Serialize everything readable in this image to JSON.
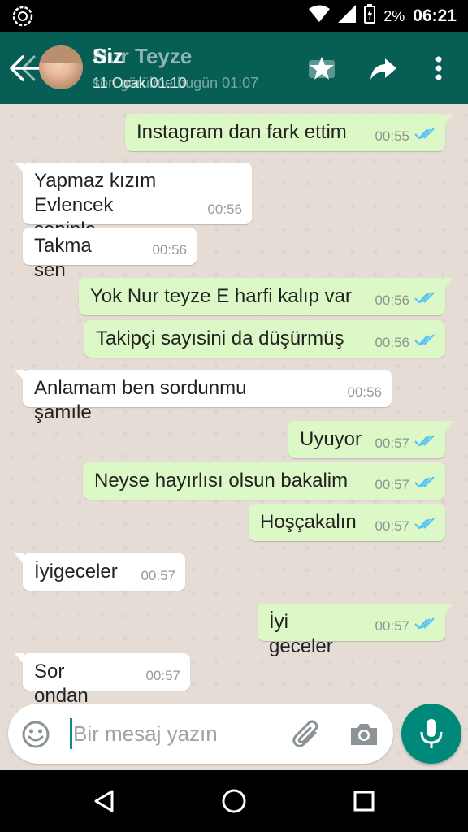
{
  "status_bar": {
    "battery_percent": "2%",
    "time": "06:21",
    "icons": [
      "notification-ring-icon",
      "wifi-icon",
      "signal-icon",
      "battery-charging-icon"
    ]
  },
  "header": {
    "name_ghost": "Nur Teyze",
    "name": "Siz",
    "subtitle_ghost": "son görülme bugün 01:07",
    "subtitle": "11 Ocak 01:10",
    "icons": [
      "back-arrow-icon",
      "avatar",
      "star-icon",
      "forward-icon",
      "more-vert-icon"
    ]
  },
  "messages": [
    {
      "dir": "out",
      "text": "Instagram dan fark ettim",
      "time": "00:55",
      "ticks": true
    },
    {
      "dir": "in",
      "text": "Yapmaz kızım\nEvlencek seninle",
      "time": "00:56",
      "ticks": false
    },
    {
      "dir": "in",
      "text": "Takma sen",
      "time": "00:56",
      "ticks": false
    },
    {
      "dir": "out",
      "text": "Yok Nur teyze E harfi kalıp var",
      "time": "00:56",
      "ticks": true
    },
    {
      "dir": "out",
      "text": "Takipçi sayısini da düşürmüş",
      "time": "00:56",
      "ticks": true
    },
    {
      "dir": "in",
      "text": "Anlamam ben sordunmu şamıle",
      "time": "00:56",
      "ticks": false
    },
    {
      "dir": "out",
      "text": "Uyuyor",
      "time": "00:57",
      "ticks": true
    },
    {
      "dir": "out",
      "text": "Neyse hayırlısı olsun bakalim",
      "time": "00:57",
      "ticks": true
    },
    {
      "dir": "out",
      "text": "Hoşçakalın",
      "time": "00:57",
      "ticks": true
    },
    {
      "dir": "in",
      "text": "İyigeceler",
      "time": "00:57",
      "ticks": false
    },
    {
      "dir": "out",
      "text": "İyi geceler",
      "time": "00:57",
      "ticks": true
    },
    {
      "dir": "in",
      "text": "Sor ondan",
      "time": "00:57",
      "ticks": false
    }
  ],
  "input": {
    "placeholder": "Bir mesaj yazın",
    "value": ""
  },
  "colors": {
    "header": "#075E54",
    "outgoing_bubble": "#dcf8c6",
    "incoming_bubble": "#ffffff",
    "read_ticks": "#4fc3f7",
    "mic_button": "#00897B"
  }
}
